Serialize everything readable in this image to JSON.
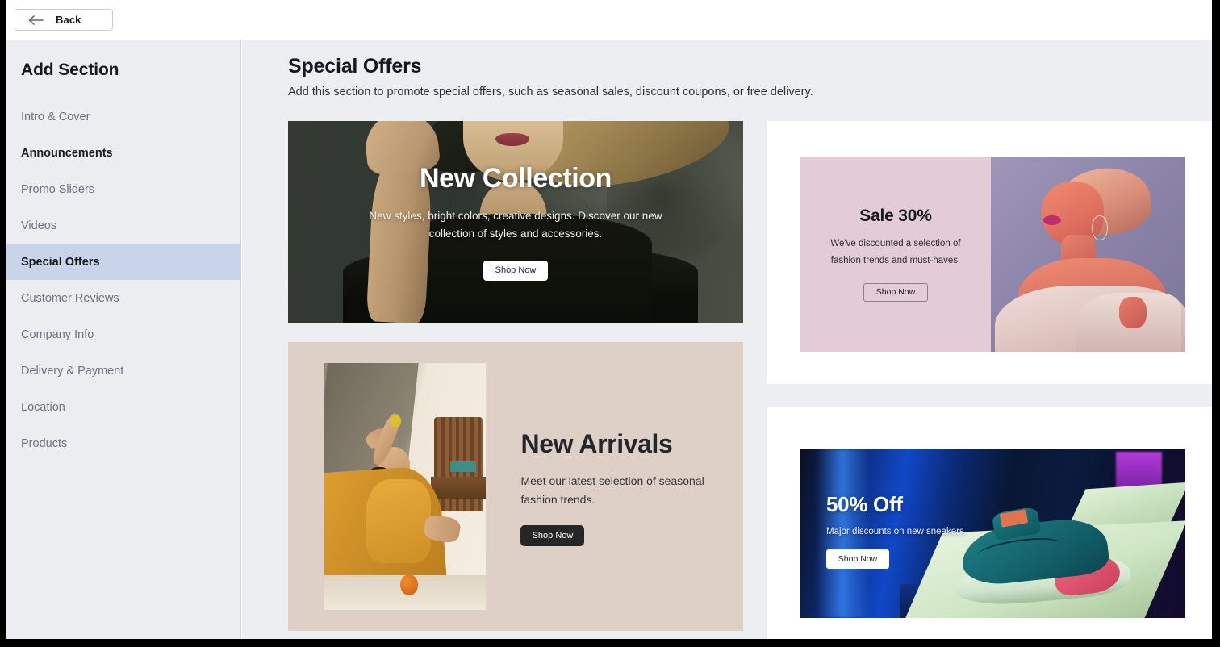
{
  "topbar": {
    "back_label": "Back",
    "back_icon": "arrow-left-icon"
  },
  "sidebar": {
    "title": "Add Section",
    "items": [
      {
        "label": "Intro & Cover",
        "state": "normal"
      },
      {
        "label": "Announcements",
        "state": "strong"
      },
      {
        "label": "Promo Sliders",
        "state": "normal"
      },
      {
        "label": "Videos",
        "state": "normal"
      },
      {
        "label": "Special Offers",
        "state": "selected"
      },
      {
        "label": "Customer Reviews",
        "state": "normal"
      },
      {
        "label": "Company Info",
        "state": "normal"
      },
      {
        "label": "Delivery & Payment",
        "state": "normal"
      },
      {
        "label": "Location",
        "state": "normal"
      },
      {
        "label": "Products",
        "state": "normal"
      }
    ]
  },
  "main": {
    "title": "Special Offers",
    "description": "Add this section to promote special offers, such as seasonal sales, discount coupons, or free delivery."
  },
  "cards": {
    "collection": {
      "title": "New Collection",
      "text": "New styles, bright colors, creative designs. Discover our new collection of styles and accessories.",
      "button": "Shop Now"
    },
    "arrivals": {
      "title": "New Arrivals",
      "text": "Meet our latest selection of seasonal fashion trends.",
      "button": "Shop Now"
    },
    "sale": {
      "title": "Sale 30%",
      "text": "We've discounted a selection of fashion trends and must-haves.",
      "button": "Shop Now"
    },
    "off": {
      "title": "50% Off",
      "text": "Major discounts on new sneakers.",
      "button": "Shop Now"
    }
  },
  "colors": {
    "selected_nav": "#c9d4ea",
    "sidebar_bg": "#ebedf0",
    "content_bg": "#eceef1",
    "sale_bg": "#e3ccd5",
    "arrivals_bg": "#ded0c6",
    "dark_button": "#262626"
  }
}
